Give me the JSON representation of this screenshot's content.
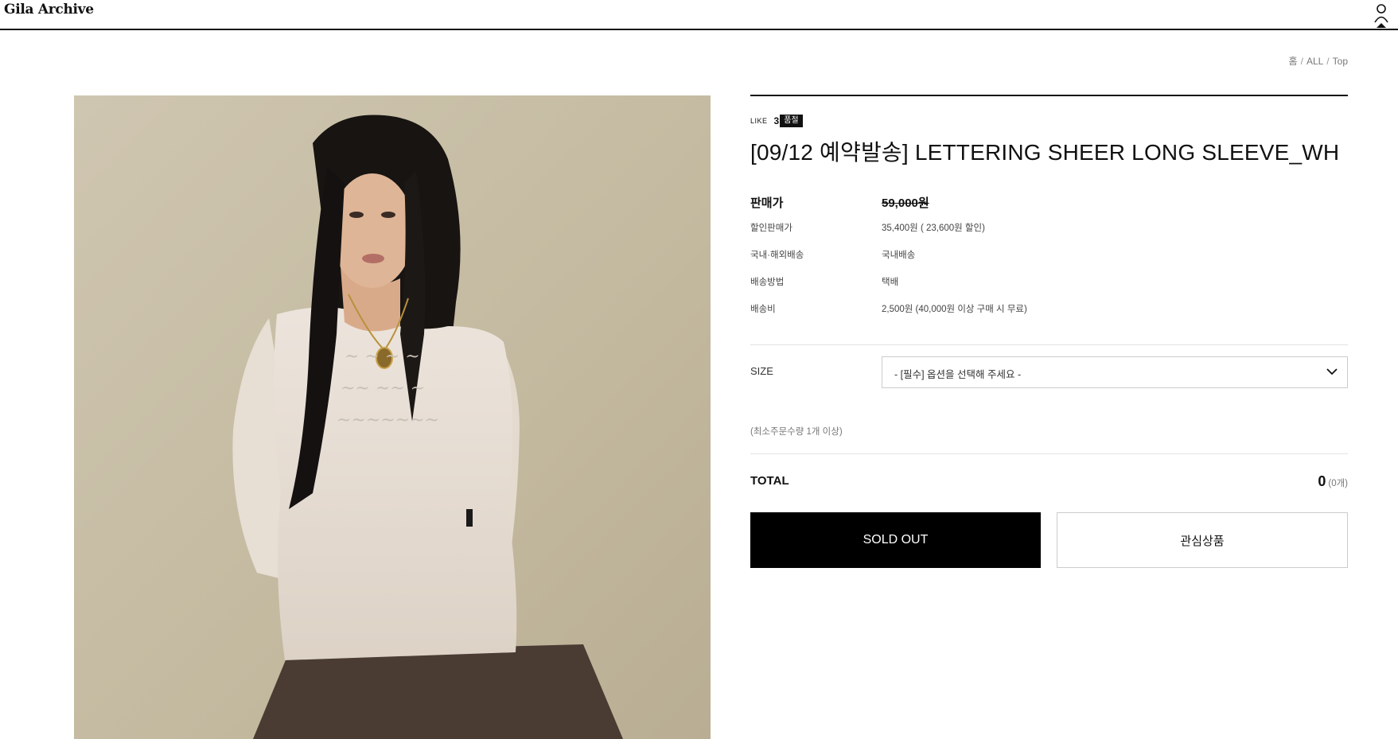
{
  "header": {
    "logo": "Gila Archive",
    "account_icon": "user-icon"
  },
  "breadcrumb": [
    "홈",
    "ALL",
    "Top"
  ],
  "product": {
    "like_label": "LIKE",
    "like_count": "3",
    "soldout_badge": "품절",
    "title": "[09/12 예약발송] LETTERING SHEER LONG SLEEVE_WH",
    "specs": [
      {
        "label": "판매가",
        "value": "59,000원"
      },
      {
        "label": "할인판매가",
        "value": "35,400원 ( 23,600원 할인)"
      },
      {
        "label": "국내·해외배송",
        "value": "국내배송"
      },
      {
        "label": "배송방법",
        "value": "택배"
      },
      {
        "label": "배송비",
        "value": "2,500원 (40,000원 이상 구매 시 무료)"
      }
    ],
    "option": {
      "label": "SIZE",
      "selected": "- [필수] 옵션을 선택해 주세요 -",
      "icon": "chevron-down-icon"
    },
    "min_order": "(최소주문수량 1개 이상)",
    "total": {
      "label": "TOTAL",
      "amount": "0",
      "quantity": "(0개)"
    },
    "buttons": {
      "sold_out": "SOLD OUT",
      "wishlist": "관심상품"
    }
  },
  "colors": {
    "accent": "#000000",
    "rule": "#e2e2e2",
    "muted_text": "#777777"
  }
}
